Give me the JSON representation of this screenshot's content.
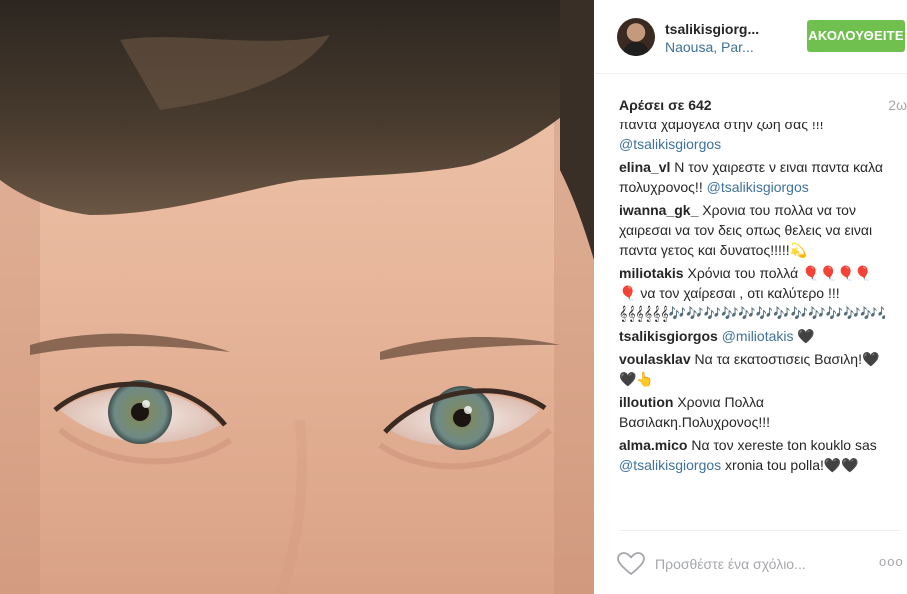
{
  "post": {
    "user": {
      "name": "tsalikisgiorg...",
      "location": "Naousa, Par..."
    },
    "follow_label": "ΑΚΟΛΟΥΘΕΙΤΕ",
    "likes_label": "Αρέσει σε 642",
    "age": "2ω",
    "comments": [
      {
        "author": "",
        "text": "παντα χαμόγελα στην ζωή σας !!! ",
        "mention": "@tsalikisgiorgos",
        "tail": ""
      },
      {
        "author": "elina_vl",
        "text": " Ν τον χαιρεστε ν ειναι παντα καλα πολυχρονος!! ",
        "mention": "@tsalikisgiorgos",
        "tail": ""
      },
      {
        "author": "iwanna_gk_",
        "text": " Χρονια του πολλα να τον χαιρεσαι να τον δεις οπως θελεις να ειναι παντα γετος και δυνατος!!!!!💫",
        "mention": "",
        "tail": ""
      },
      {
        "author": "miliotakis",
        "text": " Χρόνια του πολλά 🎈🎈🎈🎈🎈 να τον χαίρεσαι , οτι καλύτερο !!! 𝄞𝄞𝄞𝄞𝄞𝄞🎶🎶🎶🎶🎶🎶🎶🎶🎶🎶🎶🎶🎶🎶🎶🎶🎶🎶🎶🎶🎶🎶",
        "mention": "",
        "tail": ""
      },
      {
        "author": "tsalikisgiorgos",
        "text": " ",
        "mention": "@miliotakis",
        "tail": " 🖤"
      },
      {
        "author": "voulasklav",
        "text": " Να τα εκατοστισεις Βασιλη!🖤🖤👆",
        "mention": "",
        "tail": ""
      },
      {
        "author": "illoution",
        "text": " Χρονια Πολλα Βασιλακη.Πολυχρονος!!!",
        "mention": "",
        "tail": ""
      },
      {
        "author": "alma.mico",
        "text": " Να τον xereste ton kouklo sas ",
        "mention": "@tsalikisgiorgos",
        "tail": " xronia tou polla!🖤🖤"
      }
    ],
    "comment_placeholder": "Προσθέστε ένα σχόλιο...",
    "more_label": "ooo"
  },
  "icons": {
    "like": "heart-outline-icon",
    "more": "more-options-icon"
  },
  "colors": {
    "follow": "#70c050",
    "link": "#3f729b",
    "muted": "#a5a7aa",
    "text": "#262626"
  }
}
